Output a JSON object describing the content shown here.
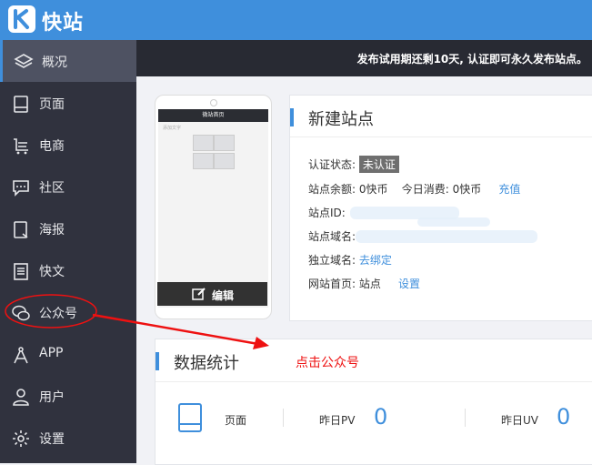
{
  "app": {
    "title": "快站",
    "logo_letter": "K"
  },
  "sidebar": {
    "items": [
      {
        "label": "概况",
        "icon": "layers-icon",
        "active": true
      },
      {
        "label": "页面",
        "icon": "tablet-icon"
      },
      {
        "label": "电商",
        "icon": "cart-icon"
      },
      {
        "label": "社区",
        "icon": "chat-icon"
      },
      {
        "label": "海报",
        "icon": "poster-icon"
      },
      {
        "label": "快文",
        "icon": "document-icon"
      },
      {
        "label": "公众号",
        "icon": "wechat-icon"
      },
      {
        "label": "APP",
        "icon": "compass-icon"
      },
      {
        "label": "用户",
        "icon": "user-icon"
      },
      {
        "label": "设置",
        "icon": "gear-icon"
      }
    ]
  },
  "notice": {
    "text": "发布试用期还剩10天, 认证即可永久发布站点。"
  },
  "preview": {
    "phone_title": "微站首页",
    "phone_sub": "添加文字",
    "edit_label": "编辑"
  },
  "site_card": {
    "title": "新建站点",
    "cert_label": "认证状态:",
    "cert_badge": "未认证",
    "balance_label": "站点余额: 0快币",
    "today_label": "今日消费: 0快币",
    "recharge": "充值",
    "site_id_label": "站点ID:",
    "domain_label": "站点域名:",
    "custom_domain_label": "独立域名:",
    "bind_link": "去绑定",
    "homepage_label": "网站首页: 站点",
    "settings_link": "设置"
  },
  "stats_card": {
    "title": "数据统计",
    "annotation": "点击公众号",
    "row_label": "页面",
    "pv_label": "昨日PV",
    "pv_value": "0",
    "uv_label": "昨日UV",
    "uv_value": "0"
  },
  "colors": {
    "accent": "#3f8fdc",
    "sidebar": "#30323e",
    "annotation": "#e11"
  }
}
